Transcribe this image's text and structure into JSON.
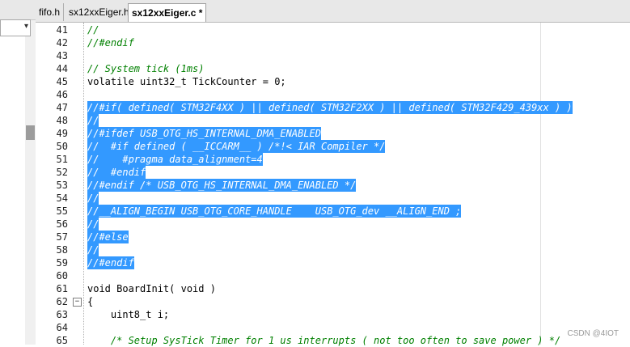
{
  "tabs": [
    {
      "label": "fifo.h"
    },
    {
      "label": "sx12xxEiger.h"
    },
    {
      "label": "sx12xxEiger.c *"
    }
  ],
  "editor": {
    "lines": [
      {
        "num": "41",
        "text": "//",
        "style": "comment"
      },
      {
        "num": "42",
        "text": "//#endif",
        "style": "comment"
      },
      {
        "num": "43",
        "text": "",
        "style": "normal"
      },
      {
        "num": "44",
        "text": "// System tick (1ms)",
        "style": "comment"
      },
      {
        "num": "45",
        "text": "volatile uint32_t TickCounter = 0;",
        "style": "normal"
      },
      {
        "num": "46",
        "text": "",
        "style": "normal"
      },
      {
        "num": "47",
        "text": "//#if( defined( STM32F4XX ) || defined( STM32F2XX ) || defined( STM32F429_439xx ) )",
        "style": "sel"
      },
      {
        "num": "48",
        "text": "//",
        "style": "sel"
      },
      {
        "num": "49",
        "text": "//#ifdef USB_OTG_HS_INTERNAL_DMA_ENABLED",
        "style": "sel"
      },
      {
        "num": "50",
        "text": "//  #if defined ( __ICCARM__ ) /*!< IAR Compiler */",
        "style": "sel"
      },
      {
        "num": "51",
        "text": "//    #pragma data_alignment=4",
        "style": "sel"
      },
      {
        "num": "52",
        "text": "//  #endif",
        "style": "sel"
      },
      {
        "num": "53",
        "text": "//#endif /* USB_OTG_HS_INTERNAL_DMA_ENABLED */",
        "style": "sel"
      },
      {
        "num": "54",
        "text": "//",
        "style": "sel"
      },
      {
        "num": "55",
        "text": "//__ALIGN_BEGIN USB_OTG_CORE_HANDLE    USB_OTG_dev __ALIGN_END ;",
        "style": "sel"
      },
      {
        "num": "56",
        "text": "//",
        "style": "sel"
      },
      {
        "num": "57",
        "text": "//#else",
        "style": "sel"
      },
      {
        "num": "58",
        "text": "//",
        "style": "sel"
      },
      {
        "num": "59",
        "text": "//#endif",
        "style": "sel"
      },
      {
        "num": "60",
        "text": "",
        "style": "normal"
      },
      {
        "num": "61",
        "text": "void BoardInit( void )",
        "style": "normal"
      },
      {
        "num": "62",
        "text": "{",
        "style": "normal",
        "fold": "−"
      },
      {
        "num": "63",
        "text": "    uint8_t i;",
        "style": "normal"
      },
      {
        "num": "64",
        "text": "",
        "style": "normal"
      },
      {
        "num": "65",
        "text": "    /* Setup SysTick Timer for 1 us interrupts ( not too often to save power ) */",
        "style": "comment"
      }
    ]
  },
  "watermark": "CSDN @4IOT",
  "colors": {
    "selection": "#3399ff",
    "comment": "#008000"
  }
}
